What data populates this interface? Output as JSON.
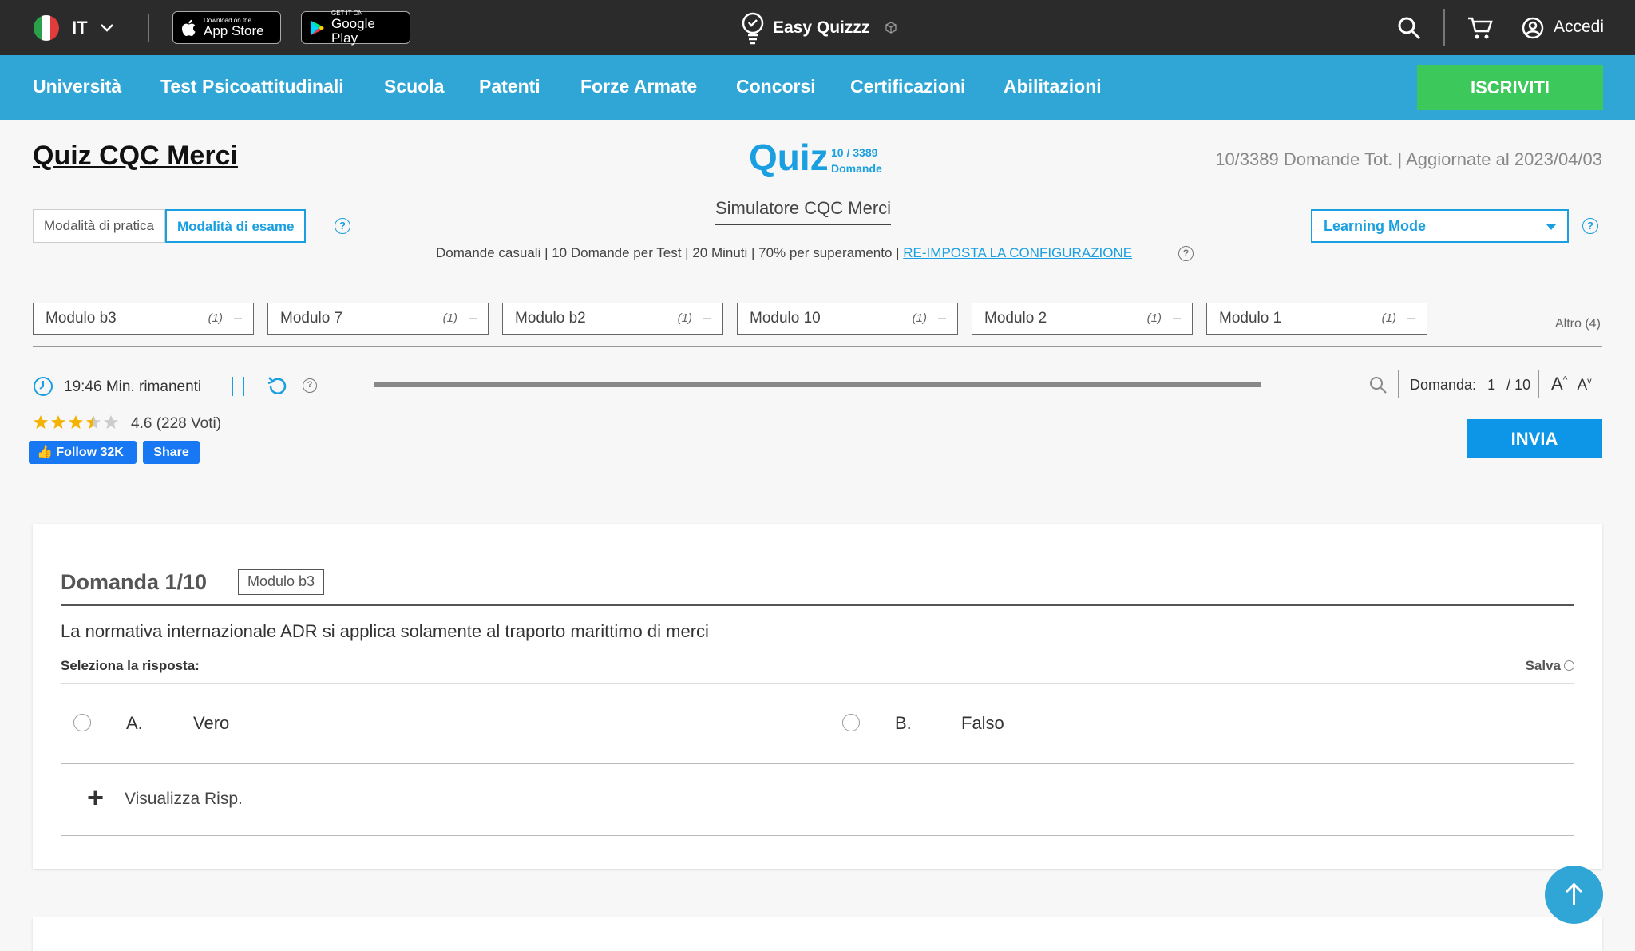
{
  "topbar": {
    "lang": "IT",
    "appstore_small": "Download on the",
    "appstore_big": "App Store",
    "googleplay_small": "GET IT ON",
    "googleplay_big": "Google Play",
    "brand": "Easy Quizzz",
    "login": "Accedi"
  },
  "nav": {
    "items": [
      "Università",
      "Test Psicoattitudinali",
      "Scuola",
      "Patenti",
      "Forze Armate",
      "Concorsi",
      "Certificazioni",
      "Abilitazioni"
    ],
    "signup": "ISCRIVITI"
  },
  "header": {
    "title": "Quiz CQC Merci",
    "quiz_word": "Quiz",
    "quiz_count": "10 / 3389",
    "quiz_domande": "Domande",
    "meta": "10/3389 Domande Tot. | Aggiornate al 2023/04/03"
  },
  "modes": {
    "practice": "Modalità di pratica",
    "exam": "Modalità di esame",
    "simulator": "Simulatore CQC Merci",
    "config_text": "Domande casuali | 10 Domande per Test | 20 Minuti | 70% per superamento | ",
    "config_link": "RE-IMPOSTA LA CONFIGURAZIONE",
    "learning_select": "Learning Mode"
  },
  "modules": [
    {
      "name": "Modulo b3",
      "count": "(1)"
    },
    {
      "name": "Modulo 7",
      "count": "(1)"
    },
    {
      "name": "Modulo b2",
      "count": "(1)"
    },
    {
      "name": "Modulo 10",
      "count": "(1)"
    },
    {
      "name": "Modulo 2",
      "count": "(1)"
    },
    {
      "name": "Modulo 1",
      "count": "(1)"
    }
  ],
  "altro": "Altro (4)",
  "timer": {
    "remaining": "19:46 Min. rimanenti",
    "domanda_label": "Domanda:",
    "current": "1",
    "total": "/ 10",
    "font_up": "A",
    "font_down": "A"
  },
  "rating": {
    "value": 4.6,
    "text": "4.6  (228 Voti)",
    "fb_follow": "Follow 32K",
    "fb_share": "Share"
  },
  "submit": "INVIA",
  "question": {
    "title": "Domanda 1/10",
    "tag": "Modulo b3",
    "text": "La normativa internazionale ADR si applica solamente al traporto marittimo di merci",
    "select_label": "Seleziona la risposta:",
    "save": "Salva",
    "options": [
      {
        "letter": "A.",
        "text": "Vero"
      },
      {
        "letter": "B.",
        "text": "Falso"
      }
    ],
    "reveal": "Visualizza Risp."
  },
  "colors": {
    "accent": "#1a9fe0",
    "nav": "#2fa6d6",
    "signup": "#3cc85b",
    "topbar": "#2b2b2b",
    "star": "#f5b301"
  }
}
